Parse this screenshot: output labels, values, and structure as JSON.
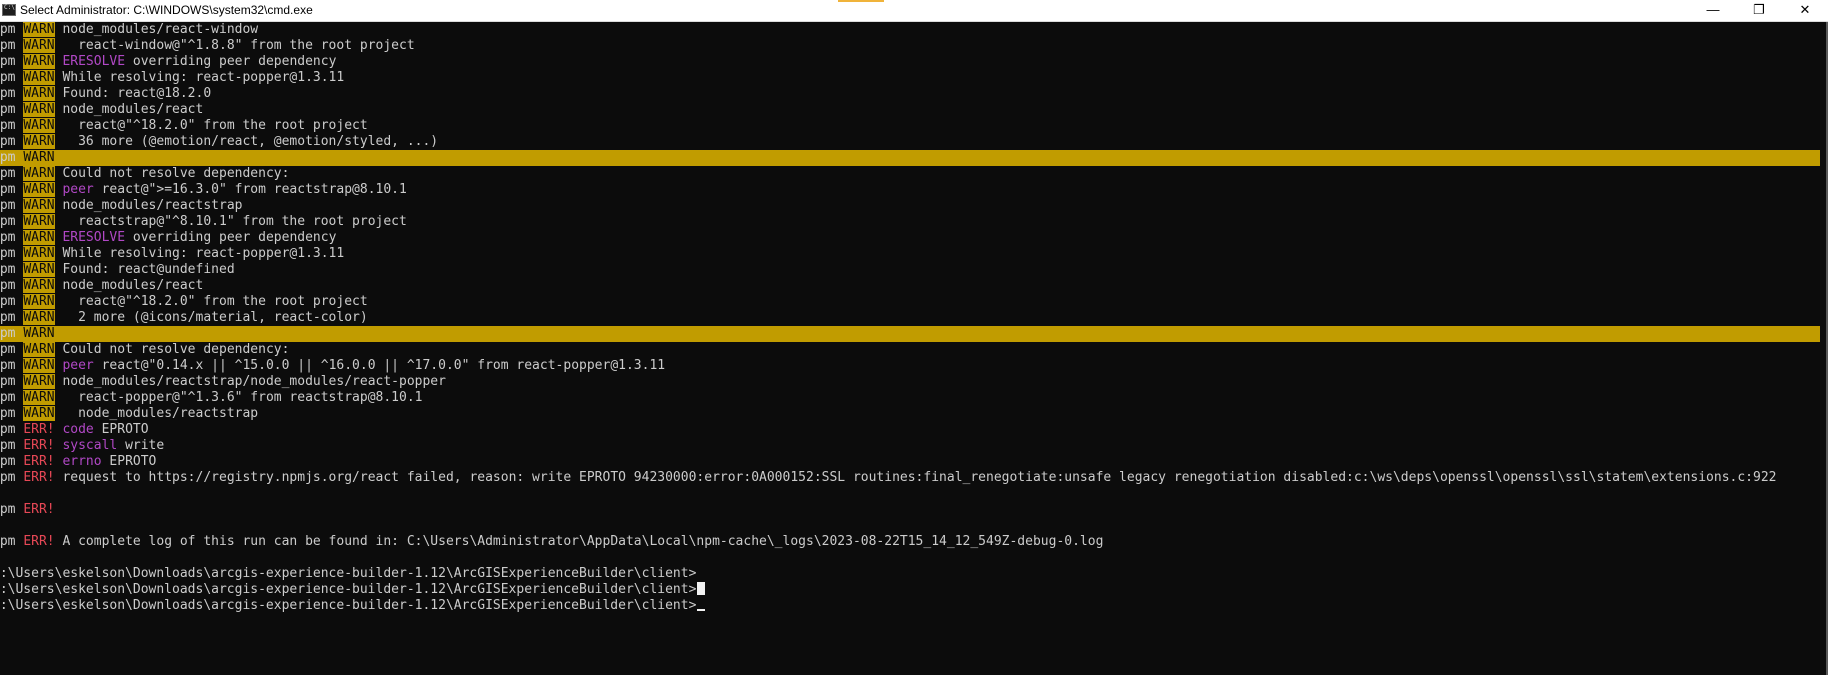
{
  "window": {
    "title": "Select Administrator: C:\\WINDOWS\\system32\\cmd.exe",
    "minimize": "—",
    "maximize": "❐",
    "close": "✕"
  },
  "terminal": {
    "lines": [
      {
        "prefix": "npm ",
        "tag": "WARN",
        "kw": "",
        "text": "node_modules/react-window"
      },
      {
        "prefix": "npm ",
        "tag": "WARN",
        "kw": "",
        "text": "  react-window@\"^1.8.8\" from the root project"
      },
      {
        "prefix": "npm ",
        "tag": "WARN",
        "kw": "ERESOLVE",
        "text": " overriding peer dependency"
      },
      {
        "prefix": "npm ",
        "tag": "WARN",
        "kw": "",
        "text": "While resolving: react-popper@1.3.11"
      },
      {
        "prefix": "npm ",
        "tag": "WARN",
        "kw": "",
        "text": "Found: react@18.2.0"
      },
      {
        "prefix": "npm ",
        "tag": "WARN",
        "kw": "",
        "text": "node_modules/react"
      },
      {
        "prefix": "npm ",
        "tag": "WARN",
        "kw": "",
        "text": "  react@\"^18.2.0\" from the root project"
      },
      {
        "prefix": "npm ",
        "tag": "WARN",
        "kw": "",
        "text": "  36 more (@emotion/react, @emotion/styled, ...)"
      },
      {
        "prefix": "npm ",
        "tag": "WARN",
        "kw": "",
        "text": "",
        "highlight": true
      },
      {
        "prefix": "npm ",
        "tag": "WARN",
        "kw": "",
        "text": "Could not resolve dependency:"
      },
      {
        "prefix": "npm ",
        "tag": "WARN",
        "kw": "peer",
        "text": " react@\">=16.3.0\" from reactstrap@8.10.1"
      },
      {
        "prefix": "npm ",
        "tag": "WARN",
        "kw": "",
        "text": "node_modules/reactstrap"
      },
      {
        "prefix": "npm ",
        "tag": "WARN",
        "kw": "",
        "text": "  reactstrap@\"^8.10.1\" from the root project"
      },
      {
        "prefix": "npm ",
        "tag": "WARN",
        "kw": "ERESOLVE",
        "text": " overriding peer dependency"
      },
      {
        "prefix": "npm ",
        "tag": "WARN",
        "kw": "",
        "text": "While resolving: react-popper@1.3.11"
      },
      {
        "prefix": "npm ",
        "tag": "WARN",
        "kw": "",
        "text": "Found: react@undefined"
      },
      {
        "prefix": "npm ",
        "tag": "WARN",
        "kw": "",
        "text": "node_modules/react"
      },
      {
        "prefix": "npm ",
        "tag": "WARN",
        "kw": "",
        "text": "  react@\"^18.2.0\" from the root project"
      },
      {
        "prefix": "npm ",
        "tag": "WARN",
        "kw": "",
        "text": "  2 more (@icons/material, react-color)"
      },
      {
        "prefix": "npm ",
        "tag": "WARN",
        "kw": "",
        "text": "",
        "highlight": true
      },
      {
        "prefix": "npm ",
        "tag": "WARN",
        "kw": "",
        "text": "Could not resolve dependency:"
      },
      {
        "prefix": "npm ",
        "tag": "WARN",
        "kw": "peer",
        "text": " react@\"0.14.x || ^15.0.0 || ^16.0.0 || ^17.0.0\" from react-popper@1.3.11"
      },
      {
        "prefix": "npm ",
        "tag": "WARN",
        "kw": "",
        "text": "node_modules/reactstrap/node_modules/react-popper"
      },
      {
        "prefix": "npm ",
        "tag": "WARN",
        "kw": "",
        "text": "  react-popper@\"^1.3.6\" from reactstrap@8.10.1"
      },
      {
        "prefix": "npm ",
        "tag": "WARN",
        "kw": "",
        "text": "  node_modules/reactstrap"
      },
      {
        "prefix": "npm ",
        "tag": "ERR!",
        "kw": "code",
        "text": " EPROTO"
      },
      {
        "prefix": "npm ",
        "tag": "ERR!",
        "kw": "syscall",
        "text": " write"
      },
      {
        "prefix": "npm ",
        "tag": "ERR!",
        "kw": "errno",
        "text": " EPROTO"
      },
      {
        "prefix": "npm ",
        "tag": "ERR!",
        "kw": "",
        "text": "request to https://registry.npmjs.org/react failed, reason: write EPROTO 94230000:error:0A000152:SSL routines:final_renegotiate:unsafe legacy renegotiation disabled:c:\\ws\\deps\\openssl\\openssl\\ssl\\statem\\extensions.c:922"
      },
      {
        "prefix": ":",
        "tag": "",
        "kw": "",
        "text": ""
      },
      {
        "prefix": "npm ",
        "tag": "ERR!",
        "kw": "",
        "text": ""
      },
      {
        "prefix": "",
        "tag": "",
        "kw": "",
        "text": ""
      },
      {
        "prefix": "npm ",
        "tag": "ERR!",
        "kw": "",
        "text": "A complete log of this run can be found in: C:\\Users\\Administrator\\AppData\\Local\\npm-cache\\_logs\\2023-08-22T15_14_12_549Z-debug-0.log"
      },
      {
        "prefix": "",
        "tag": "",
        "kw": "",
        "text": ""
      },
      {
        "prefix": "",
        "tag": "",
        "kw": "",
        "text": "C:\\Users\\eskelson\\Downloads\\arcgis-experience-builder-1.12\\ArcGISExperienceBuilder\\client>"
      },
      {
        "prefix": "",
        "tag": "",
        "kw": "",
        "text": "C:\\Users\\eskelson\\Downloads\\arcgis-experience-builder-1.12\\ArcGISExperienceBuilder\\client>",
        "cursor": "block"
      },
      {
        "prefix": "",
        "tag": "",
        "kw": "",
        "text": "C:\\Users\\eskelson\\Downloads\\arcgis-experience-builder-1.12\\ArcGISExperienceBuilder\\client>",
        "cursor": "underline"
      }
    ]
  },
  "colors": {
    "background": "#0c0c0c",
    "foreground": "#cccccc",
    "warn": "#c19c00",
    "err": "#e74856",
    "keyword": "#b148c6"
  }
}
